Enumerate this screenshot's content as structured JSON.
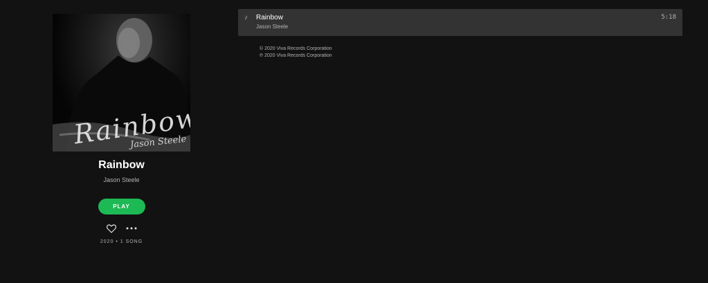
{
  "album": {
    "title": "Rainbow",
    "artist": "Jason Steele",
    "cover_art_title": "Rainbow",
    "cover_art_artist": "Jason Steele",
    "play_label": "PLAY",
    "meta": "2020 • 1 SONG"
  },
  "icons": {
    "heart": "heart-icon",
    "more": "more-icon",
    "note": "music-note-icon"
  },
  "tracks": [
    {
      "title": "Rainbow",
      "artist": "Jason Steele",
      "duration": "5:18"
    }
  ],
  "copyright": {
    "line1": "© 2020 Viva Records Corporation",
    "line2": "℗ 2020 Viva Records Corporation"
  },
  "colors": {
    "background": "#121212",
    "accent": "#1db954",
    "row_highlight": "#333333",
    "secondary_text": "#b3b3b3"
  }
}
